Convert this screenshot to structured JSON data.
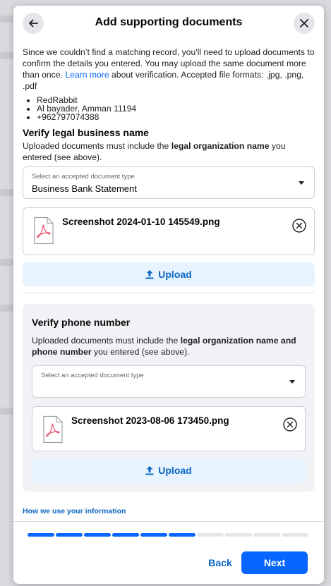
{
  "header": {
    "title": "Add supporting documents"
  },
  "intro": {
    "text_before_link": "Since we couldn’t find a matching record, you'll need to upload documents to confirm the details you entered. You may upload the same document more than once. ",
    "link_text": "Learn more",
    "text_after_link": " about verification. Accepted file formats: .jpg, .png, .pdf"
  },
  "business_details": [
    "RedRabbit",
    "Al bayader, Amman 11194",
    "+962797074388"
  ],
  "legal_section": {
    "title": "Verify legal business name",
    "desc_before": "Uploaded documents must include the ",
    "desc_bold": "legal organization name",
    "desc_after": " you entered (see above).",
    "select_label": "Select an accepted document type",
    "select_value": "Business Bank Statement",
    "file_name": "Screenshot 2024-01-10 145549.png",
    "upload_label": "Upload"
  },
  "phone_section": {
    "title": "Verify phone number",
    "desc_before": "Uploaded documents must include the ",
    "desc_bold": "legal organization name and phone number",
    "desc_after": " you entered (see above).",
    "select_label": "Select an accepted document type",
    "select_value": "",
    "file_name": "Screenshot 2023-08-06 173450.png",
    "upload_label": "Upload"
  },
  "footer": {
    "info_link": "How we use your information",
    "progress": {
      "completed_steps": 6,
      "total_steps": 10
    },
    "back_label": "Back",
    "next_label": "Next"
  },
  "colors": {
    "accent": "#0866ff",
    "link": "#0a66c2",
    "upload_bg": "#e7f3ff",
    "file_icon": "#e8546b"
  },
  "icons": {
    "back": "arrow-left-icon",
    "close": "close-icon",
    "file": "pdf-file-icon",
    "remove": "circle-x-icon",
    "upload": "upload-arrow-icon"
  }
}
